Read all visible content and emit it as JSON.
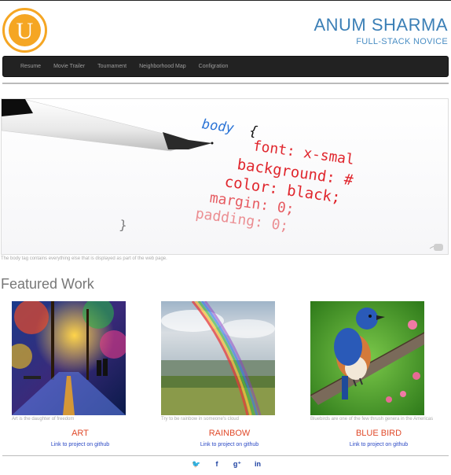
{
  "header": {
    "logo_letter": "U",
    "name": "ANUM SHARMA",
    "tagline": "FULL-STACK NOVICE"
  },
  "nav": {
    "items": [
      "Resume",
      "Movie Trailer",
      "Tournament",
      "Neighborhood Map",
      "Configration"
    ]
  },
  "hero": {
    "code": {
      "selector": "body",
      "brace": "{",
      "props": [
        "font: x-smal",
        "background: #",
        "color: black;",
        "margin: 0;",
        "padding: 0;"
      ],
      "close": "}"
    },
    "caption": "The body tag contains everything else that is displayed as part of the web page."
  },
  "featured": {
    "title": "Featured Work",
    "cards": [
      {
        "caption": "Art is the daughter of freedom",
        "title": "ART",
        "link": "Link to project on github"
      },
      {
        "caption": "Try to be rainbow in someone's cloud",
        "title": "RAINBOW",
        "link": "Link to project on github"
      },
      {
        "caption": "Bluebirds are one of the few thrush genera in the Americas",
        "title": "BLUE BIRD",
        "link": "Link to project on github"
      }
    ]
  },
  "footer": {
    "social": [
      "twitter-icon",
      "facebook-icon",
      "google-plus-icon",
      "linkedin-icon"
    ],
    "social_glyphs": [
      "🐦",
      "f",
      "g⁺",
      "in"
    ]
  },
  "colors": {
    "accent": "#f5a623",
    "name": "#3b7fb6",
    "card_title": "#e04a2a",
    "link": "#2a48c4",
    "navbar": "#222222"
  }
}
